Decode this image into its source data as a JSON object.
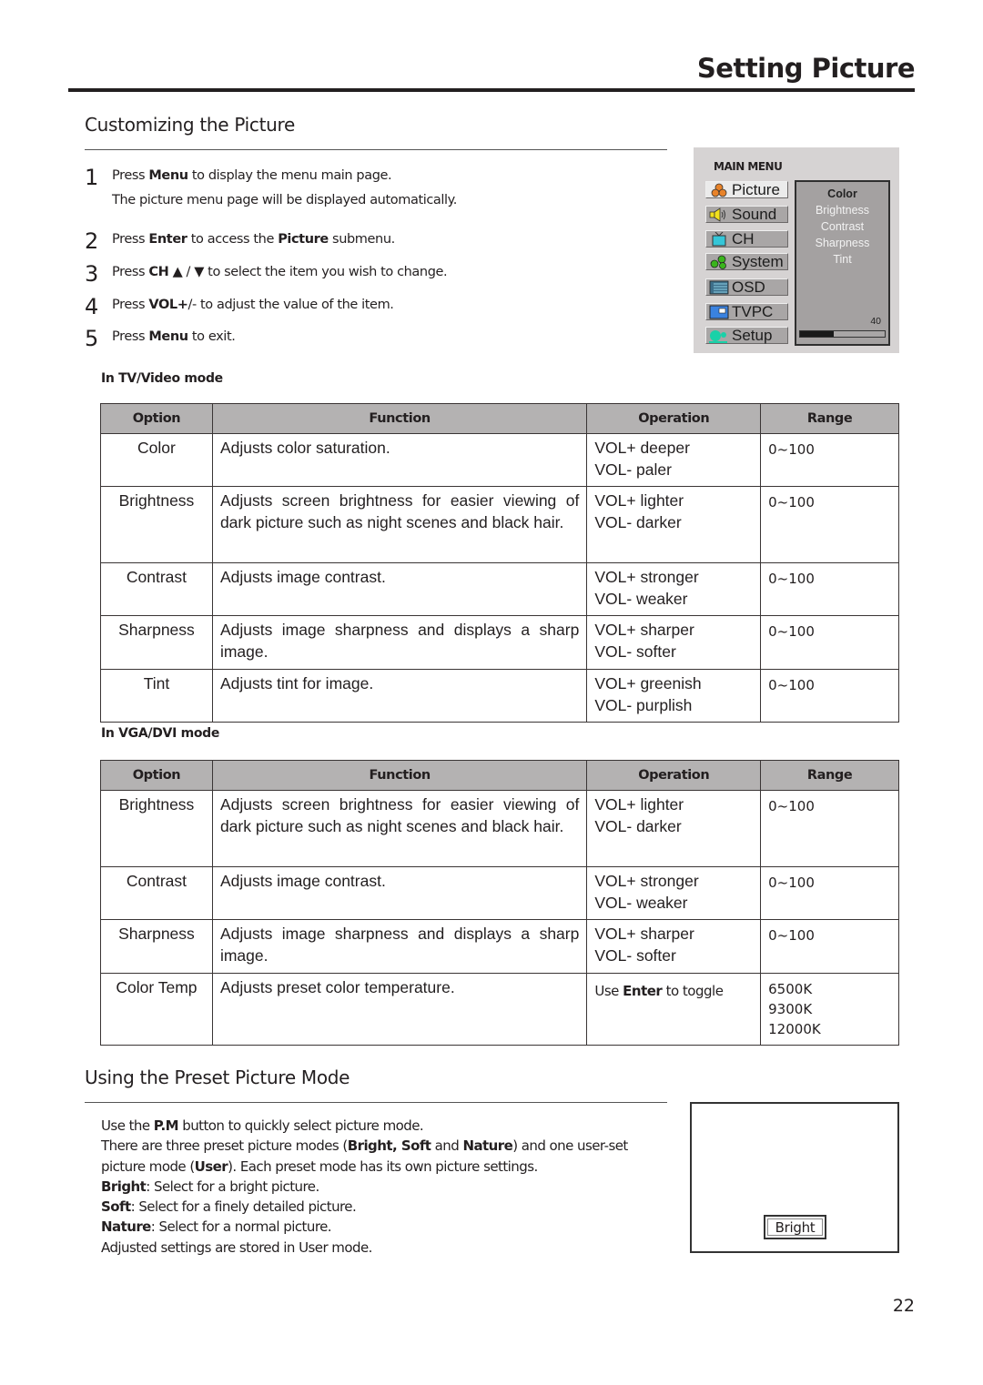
{
  "header": {
    "title": "Setting Picture"
  },
  "customizing": {
    "title": "Customizing the Picture",
    "steps": [
      {
        "num": "1",
        "parts": [
          {
            "t": "Press  "
          },
          {
            "b": "Menu"
          },
          {
            "t": " to display the menu main page."
          }
        ],
        "extra": "The picture menu page will be displayed automatically."
      },
      {
        "num": "2",
        "parts": [
          {
            "t": "Press "
          },
          {
            "b": "Enter"
          },
          {
            "t": " to access the "
          },
          {
            "b": "Picture"
          },
          {
            "t": " submenu."
          }
        ]
      },
      {
        "num": "3",
        "parts": [
          {
            "t": "Press  "
          },
          {
            "b": "CH"
          },
          {
            "t": " ▲ / ▼  to select the item you wish to change."
          }
        ]
      },
      {
        "num": "4",
        "parts": [
          {
            "t": "Press  "
          },
          {
            "b": "VOL+"
          },
          {
            "t": "/- to adjust the value of the item."
          }
        ]
      },
      {
        "num": "5",
        "parts": [
          {
            "t": "Press "
          },
          {
            "b": "Menu"
          },
          {
            "t": " to exit."
          }
        ]
      }
    ]
  },
  "osd_menu": {
    "title": "MAIN MENU",
    "items": [
      {
        "label": "Picture",
        "icon": "picture-icon",
        "active": true
      },
      {
        "label": "Sound",
        "icon": "speaker-icon",
        "active": false
      },
      {
        "label": "CH",
        "icon": "tv-icon",
        "active": false
      },
      {
        "label": "System",
        "icon": "gears-icon",
        "active": false
      },
      {
        "label": "OSD",
        "icon": "list-icon",
        "active": false
      },
      {
        "label": "TVPC",
        "icon": "monitor-icon",
        "active": false
      },
      {
        "label": "Setup",
        "icon": "setup-icon",
        "active": false
      }
    ],
    "submenu": [
      "Color",
      "Brightness",
      "Contrast",
      "Sharpness",
      "Tint"
    ],
    "active_sub": "Color",
    "value": "40",
    "level_fraction": 0.4
  },
  "tv_video": {
    "label": "In TV/Video mode",
    "headers": [
      "Option",
      "Function",
      "Operation",
      "Range"
    ],
    "rows": [
      {
        "option": "Color",
        "function": "Adjusts color saturation.",
        "op1": "VOL+  deeper",
        "op2": "VOL-  paler",
        "range": [
          "0~100"
        ]
      },
      {
        "option": "Brightness",
        "function": "Adjusts screen brightness for easier viewing of dark picture such as night scenes and black hair.",
        "op1": "VOL+  lighter",
        "op2": "VOL-  darker",
        "range": [
          "0~100"
        ]
      },
      {
        "option": "Contrast",
        "function": "Adjusts image contrast.",
        "op1": "VOL+  stronger",
        "op2": "VOL-  weaker",
        "range": [
          "0~100"
        ]
      },
      {
        "option": "Sharpness",
        "function": "Adjusts image sharpness and displays a sharp image.",
        "op1": "VOL+  sharper",
        "op2": "VOL-  softer",
        "range": [
          "0~100"
        ]
      },
      {
        "option": "Tint",
        "function": "Adjusts tint for image.",
        "op1": "VOL+  greenish",
        "op2": "VOL-  purplish",
        "range": [
          "0~100"
        ]
      }
    ]
  },
  "vga_dvi": {
    "label": "In VGA/DVI mode",
    "headers": [
      "Option",
      "Function",
      "Operation",
      "Range"
    ],
    "rows": [
      {
        "option": "Brightness",
        "function": "Adjusts screen brightness for easier viewing of dark picture such as night scenes and black hair.",
        "op1": "VOL+  lighter",
        "op2": "VOL-  darker",
        "range": [
          "0~100"
        ]
      },
      {
        "option": "Contrast",
        "function": "Adjusts image contrast.",
        "op1": "VOL+  stronger",
        "op2": "VOL-  weaker",
        "range": [
          "0~100"
        ]
      },
      {
        "option": "Sharpness",
        "function": "Adjusts image sharpness and displays a sharp image.",
        "op1": "VOL+  sharper",
        "op2": "VOL-  softer",
        "range": [
          "0~100"
        ]
      },
      {
        "option": "Color Temp",
        "function": "Adjusts preset color temperature.",
        "op_rich": [
          {
            "t": "Use "
          },
          {
            "b": "Enter"
          },
          {
            "t": " to toggle"
          }
        ],
        "range": [
          "6500K",
          "9300K",
          "12000K"
        ]
      }
    ]
  },
  "preset": {
    "title": "Using the Preset Picture Mode",
    "lines": [
      [
        {
          "t": "Use the "
        },
        {
          "b": "P.M"
        },
        {
          "t": " button to quickly select picture mode."
        }
      ],
      [
        {
          "t": "There are three preset picture modes ("
        },
        {
          "b": "Bright, Soft"
        },
        {
          "t": " and "
        },
        {
          "b": "Nature"
        },
        {
          "t": ") and one user-set picture mode ("
        },
        {
          "b": "User"
        },
        {
          "t": "). Each preset mode has its own picture settings."
        }
      ],
      [
        {
          "b": "Bright"
        },
        {
          "t": ": Select for a bright picture."
        }
      ],
      [
        {
          "b": "Soft"
        },
        {
          "t": ": Select for a finely detailed picture."
        }
      ],
      [
        {
          "b": "Nature"
        },
        {
          "t": ": Select for a normal picture."
        }
      ],
      [
        {
          "t": "Adjusted settings are stored in User mode."
        }
      ]
    ],
    "screen_badge": "Bright"
  },
  "footer": {
    "page_number": "22"
  }
}
